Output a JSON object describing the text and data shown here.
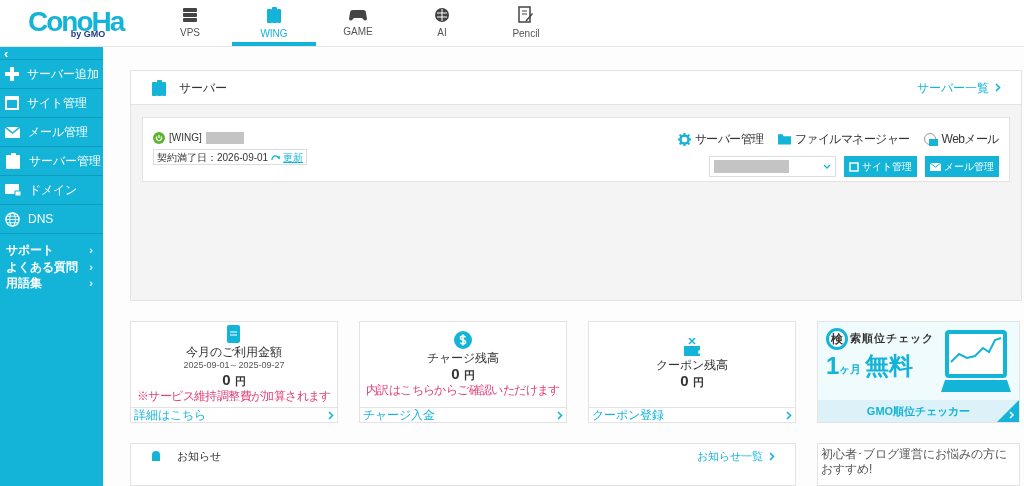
{
  "logo": {
    "text": "ConoHa",
    "sub": "by GMO"
  },
  "tabs": [
    {
      "label": "VPS",
      "selected": false
    },
    {
      "label": "WING",
      "selected": true
    },
    {
      "label": "GAME",
      "selected": false
    },
    {
      "label": "AI",
      "selected": false
    },
    {
      "label": "Pencil",
      "selected": false
    }
  ],
  "sidebar": {
    "collapse": "‹",
    "items": [
      {
        "label": "サーバー追加",
        "kind": "plus"
      },
      {
        "label": "サイト管理",
        "kind": "window"
      },
      {
        "label": "メール管理",
        "kind": "mail"
      },
      {
        "label": "サーバー管理",
        "kind": "server"
      },
      {
        "label": "ドメイン",
        "kind": "domain"
      },
      {
        "label": "DNS",
        "kind": "globe"
      }
    ],
    "links": [
      {
        "label": "サポート",
        "arrow": "›"
      },
      {
        "label": "よくある質問",
        "arrow": "›"
      },
      {
        "label": "用語集",
        "arrow": "›"
      }
    ]
  },
  "server_panel": {
    "title": "サーバー",
    "link": "サーバー一覧",
    "server": {
      "name": "[WING]",
      "running": true,
      "expiry": "契約満了日：2026-09-01",
      "renew": "更新",
      "actions": [
        {
          "label": "サーバー管理",
          "kind": "gear"
        },
        {
          "label": "ファイルマネージャー",
          "kind": "folder"
        },
        {
          "label": "Webメール",
          "kind": "webmail"
        }
      ],
      "buttons": [
        {
          "label": "サイト管理",
          "kind": "window"
        },
        {
          "label": "メール管理",
          "kind": "mail"
        }
      ]
    }
  },
  "summary_cards": [
    {
      "kind": "bill",
      "title": "今月のご利用金額",
      "period": "2025-09-01～2025-09-27",
      "amount": "0",
      "unit": "円",
      "note": "※サービス維持調整費が加算されます",
      "link": "詳細はこちら"
    },
    {
      "kind": "dollar",
      "title": "チャージ残高",
      "amount": "0",
      "unit": "円",
      "note": "内訳はこちらからご確認いただけます",
      "link": "チャージ入金"
    },
    {
      "kind": "coupon",
      "title": "クーポン残高",
      "amount": "0",
      "unit": "円",
      "link": "クーポン登録"
    }
  ],
  "banner": {
    "magnified_char": "検",
    "headline": "索順位チェック",
    "offer_number": "1",
    "offer_unit": "ヶ月",
    "offer": "無料",
    "footer": "GMO順位チェッカー"
  },
  "news": {
    "title": "お知らせ",
    "link": "お知らせ一覧"
  },
  "promo": {
    "text": "初心者･ブログ運営にお悩みの方におすすめ!"
  }
}
